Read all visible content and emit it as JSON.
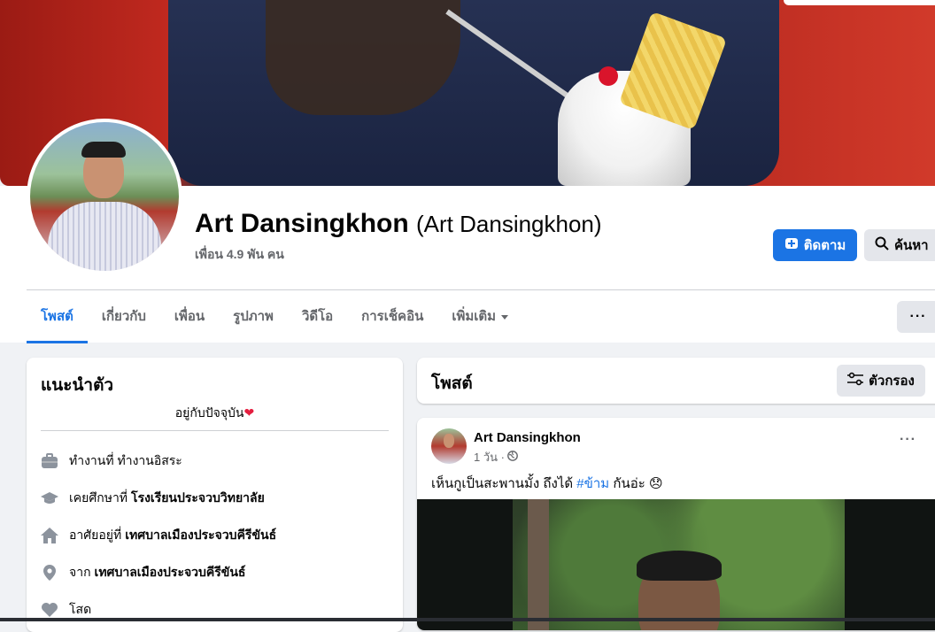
{
  "profile": {
    "name": "Art Dansingkhon",
    "alt_name": "(Art Dansingkhon)",
    "friends": "เพื่อน 4.9 พัน คน"
  },
  "actions": {
    "follow_label": "ติดตาม",
    "search_label": "ค้นหา",
    "more_label": "···"
  },
  "tabs": [
    {
      "label": "โพสต์",
      "active": true
    },
    {
      "label": "เกี่ยวกับ"
    },
    {
      "label": "เพื่อน"
    },
    {
      "label": "รูปภาพ"
    },
    {
      "label": "วิดีโอ"
    },
    {
      "label": "การเช็คอิน"
    },
    {
      "label": "เพิ่มเติม"
    }
  ],
  "intro": {
    "title": "แนะนำตัว",
    "bio": "อยู่กับปัจจุบัน",
    "bio_emoji": "❤",
    "items": [
      {
        "icon": "briefcase-icon",
        "prefix": "ทำงานที่ ทำงานอิสระ",
        "bold": ""
      },
      {
        "icon": "graduation-cap-icon",
        "prefix": "เคยศึกษาที่",
        "bold": "โรงเรียนประจวบวิทยาลัย"
      },
      {
        "icon": "home-icon",
        "prefix": "อาศัยอยู่ที่",
        "bold": "เทศบาลเมืองประจวบคีรีขันธ์"
      },
      {
        "icon": "location-pin-icon",
        "prefix": "จาก",
        "bold": "เทศบาลเมืองประจวบคีรีขันธ์"
      },
      {
        "icon": "heart-icon",
        "prefix": "โสด",
        "bold": ""
      }
    ]
  },
  "posts_header": {
    "title": "โพสต์",
    "filter_label": "ตัวกรอง"
  },
  "post": {
    "author": "Art Dansingkhon",
    "time": "1 วัน ·",
    "text_before": "เห็นกูเป็นสะพานมั้ง  ถึงได้ ",
    "hashtag": "#ข้าม",
    "text_after": " กันอ่ะ 😞",
    "more_label": "···"
  },
  "colors": {
    "accent": "#1b74e4",
    "background": "#f0f2f5",
    "secondary_text": "#65676b"
  }
}
